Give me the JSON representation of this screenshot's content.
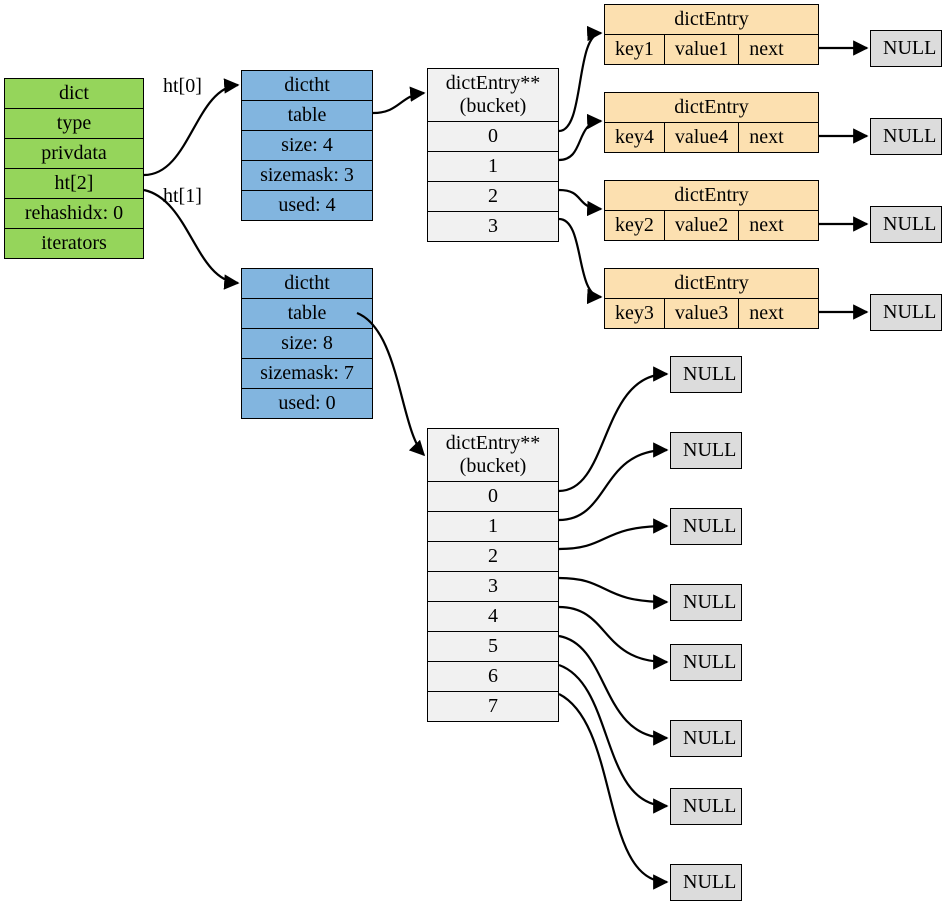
{
  "dict": {
    "title": "dict",
    "fields": [
      "type",
      "privdata",
      "ht[2]",
      "rehashidx: 0",
      "iterators"
    ]
  },
  "edgeLabels": {
    "ht0": "ht[0]",
    "ht1": "ht[1]"
  },
  "dictht0": {
    "title": "dictht",
    "fields": [
      "table",
      "size: 4",
      "sizemask: 3",
      "used: 4"
    ]
  },
  "dictht1": {
    "title": "dictht",
    "fields": [
      "table",
      "size: 8",
      "sizemask: 7",
      "used: 0"
    ]
  },
  "bucket0": {
    "title1": "dictEntry**",
    "title2": "(bucket)",
    "slots": [
      "0",
      "1",
      "2",
      "3"
    ]
  },
  "bucket1": {
    "title1": "dictEntry**",
    "title2": "(bucket)",
    "slots": [
      "0",
      "1",
      "2",
      "3",
      "4",
      "5",
      "6",
      "7"
    ]
  },
  "entries": [
    {
      "title": "dictEntry",
      "key": "key1",
      "value": "value1",
      "next": "next"
    },
    {
      "title": "dictEntry",
      "key": "key4",
      "value": "value4",
      "next": "next"
    },
    {
      "title": "dictEntry",
      "key": "key2",
      "value": "value2",
      "next": "next"
    },
    {
      "title": "dictEntry",
      "key": "key3",
      "value": "value3",
      "next": "next"
    }
  ],
  "nullText": "NULL"
}
